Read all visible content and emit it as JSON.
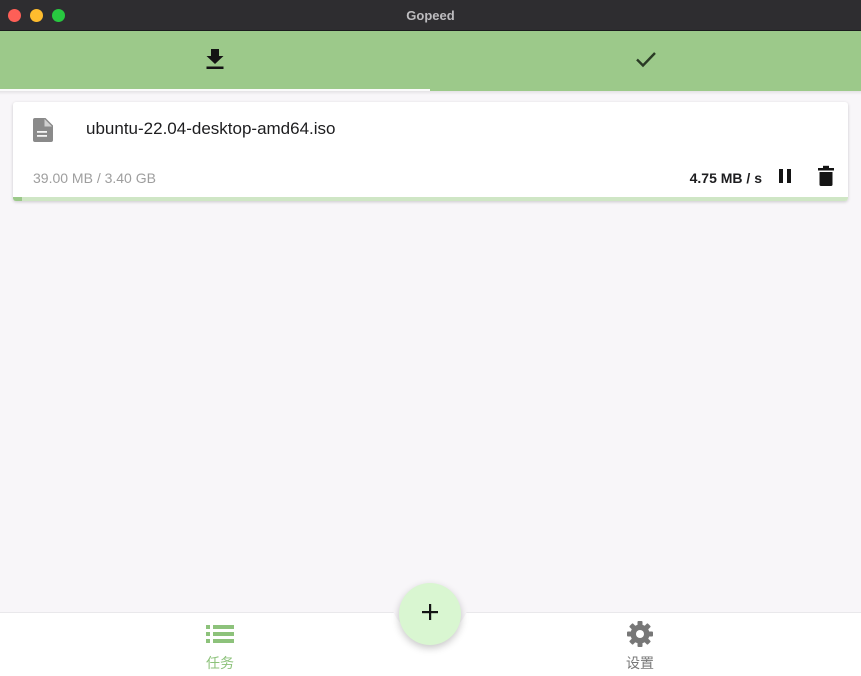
{
  "window": {
    "title": "Gopeed"
  },
  "tabs": [
    {
      "icon": "download-icon",
      "active": true
    },
    {
      "icon": "check-icon",
      "active": false
    }
  ],
  "task": {
    "name": "ubuntu-22.04-desktop-amd64.iso",
    "size": "39.00 MB / 3.40 GB",
    "speed": "4.75 MB / s",
    "progress": 0.011,
    "icons": {
      "file": "file-icon",
      "pause": "pause-icon",
      "delete": "delete-icon"
    }
  },
  "bottom_nav": {
    "tasks_label": "任务",
    "settings_label": "设置",
    "add_icon": "plus-icon"
  },
  "colors": {
    "accent": "#9cc98a",
    "fab": "#d9f6d1",
    "progress": "#9cc98a"
  }
}
